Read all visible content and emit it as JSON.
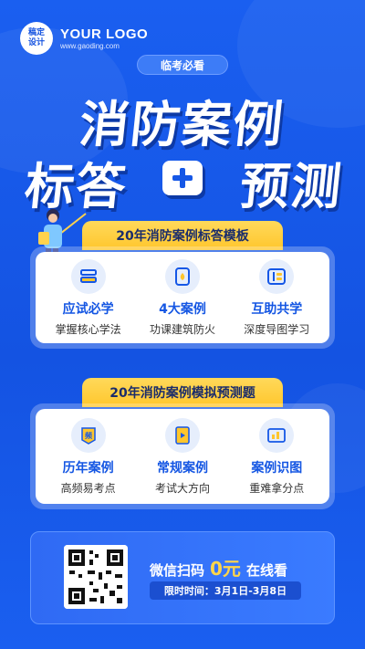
{
  "logo": {
    "badge_line1": "稿定",
    "badge_line2": "设计",
    "name": "YOUR LOGO",
    "url": "www.gaoding.com"
  },
  "pill": "临考必看",
  "title": {
    "line1": "消防案例",
    "left": "标答",
    "right": "预测"
  },
  "section1": {
    "tag": "20年消防案例标答模板",
    "items": [
      {
        "title": "应试必学",
        "sub": "掌握核心学法",
        "icon": "books-icon"
      },
      {
        "title": "4大案例",
        "sub": "功课建筑防火",
        "icon": "flame-icon"
      },
      {
        "title": "互助共学",
        "sub": "深度导图学习",
        "icon": "mindmap-icon"
      }
    ]
  },
  "section2": {
    "tag": "20年消防案例模拟预测题",
    "items": [
      {
        "title": "历年案例",
        "sub": "高频易考点",
        "icon": "frequency-badge-icon",
        "glyph": "频"
      },
      {
        "title": "常规案例",
        "sub": "考试大方向",
        "icon": "play-document-icon"
      },
      {
        "title": "案例识图",
        "sub": "重难拿分点",
        "icon": "chart-icon"
      }
    ]
  },
  "bottom": {
    "cta_prefix": "微信扫码",
    "cta_price": "0元",
    "cta_suffix": "在线看",
    "limit": "限时时间：3月1日-3月8日"
  },
  "colors": {
    "primary": "#1557e6",
    "accent": "#ffc62c",
    "text_blue": "#1456e3"
  }
}
